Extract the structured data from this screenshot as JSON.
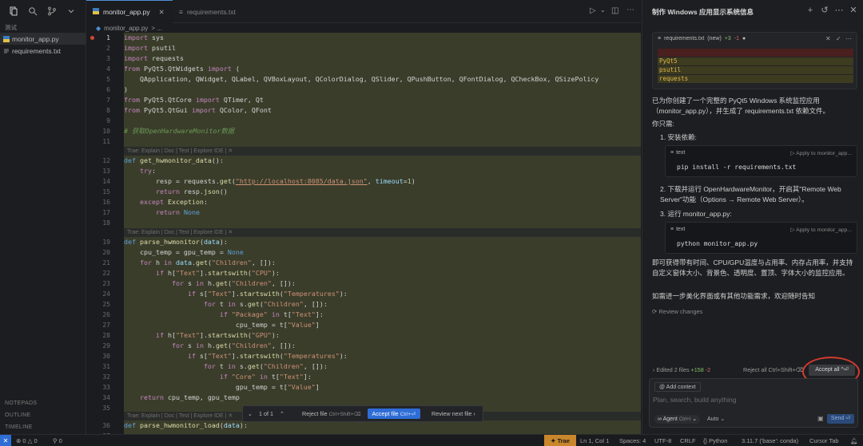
{
  "sidebar": {
    "folder_label": "测试",
    "files": [
      {
        "name": "monitor_app.py",
        "active": true
      },
      {
        "name": "requirements.txt",
        "active": false
      }
    ],
    "sections": [
      "NOTEPADS",
      "OUTLINE",
      "TIMELINE"
    ]
  },
  "tabs": [
    {
      "label": "monitor_app.py",
      "active": true
    },
    {
      "label": "requirements.txt",
      "active": false
    }
  ],
  "breadcrumb": {
    "file": "monitor_app.py",
    "rest": "> ..."
  },
  "code_lens": "Trae: Explain | Doc | Test | Explore IDE | ✕",
  "review_bar": {
    "counter": "1 of 1",
    "reject_label": "Reject file",
    "reject_kbd": "Ctrl+Shift+⌫",
    "accept_label": "Accept file",
    "accept_kbd": "Ctrl+⏎",
    "next_label": "Review next file"
  },
  "panel": {
    "title": "制作 Windows 应用显示系统信息",
    "diff_card": {
      "filename": "requirements.txt",
      "tag": "(new)",
      "added": "+3",
      "removed": "-1",
      "lines": [
        "PyQt5",
        "psutil",
        "requests"
      ]
    },
    "intro": "已为你创建了一个完整的 PyQt5 Windows 系统监控应用（monitor_app.py），并生成了 requirements.txt 依赖文件。",
    "need": "你只需:",
    "step1": "1. 安装依赖:",
    "block1": {
      "lang": "text",
      "apply": "Apply to monitor_app...",
      "code": "pip install -r requirements.txt"
    },
    "step2": "2. 下载并运行 OpenHardwareMonitor，开启其\"Remote Web Server\"功能（Options → Remote Web Server）。",
    "step3": "3. 运行 monitor_app.py:",
    "block2": {
      "lang": "text",
      "apply": "Apply to monitor_app...",
      "code": "python monitor_app.py"
    },
    "summary": "即可获得带有时间、CPU/GPU温度与占用率、内存占用率，并支持自定义窗体大小、背景色、透明度、置顶、字体大小的监控应用。",
    "closing": "如需进一步美化界面或有其他功能需求，欢迎随时告知",
    "review_changes": "Review changes",
    "edited": "Edited 2 files",
    "edited_add": "+158",
    "edited_del": "-2",
    "reject_all": "Reject all Ctrl+Shift+⌫",
    "accept_all": "Accept all ^⏎",
    "add_context": "Add context",
    "input_placeholder": "Plan, search, build anything",
    "mode": "Agent",
    "mode_kbd": "Ctrl+I",
    "model": "Auto",
    "send": "Send"
  },
  "status": {
    "errors": "0",
    "warnings": "0",
    "ports": "0",
    "trae": "Trae",
    "position": "Ln 1, Col 1",
    "spaces": "Spaces: 4",
    "encoding": "UTF-8",
    "eol": "CRLF",
    "language": "Python",
    "interpreter": "3.11.7 ('base': conda)",
    "cursor_tab": "Cursor Tab"
  },
  "colors": {
    "accent": "#2e6dd6",
    "trae": "#c9862b",
    "highlight_ring": "#d43b2e",
    "added_bg": "#3a3d2a"
  }
}
